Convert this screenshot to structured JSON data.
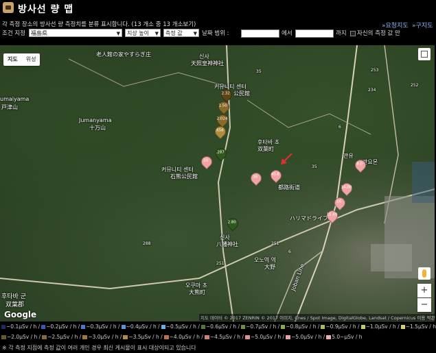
{
  "header": {
    "title": "방사선 량 맵",
    "description": "각 측정 장소의 방사선 량 측정치를 분류 표시합니다. (13 개소 중 13 개소보기)",
    "link_prefecture": "»요청지도",
    "link_city": "»구지도"
  },
  "filters": {
    "condition_label": "조건 지정",
    "prefecture_value": "福島県",
    "height_value": "지상 높이",
    "value_type": "측정 값",
    "date_range_label": "날짜 범위 :",
    "from_label": "에서",
    "to_label": "까지",
    "own_only_label": "자신의 측정 값 만"
  },
  "map": {
    "type_map": "지도",
    "type_satellite": "위성",
    "labels": {
      "top_shrine": "老人館の家やすらぎ庄",
      "shinsai": "신사",
      "tenjin": "天照皇神神社",
      "community_top": "커뮤니티 센터",
      "kominkan_top": "公民館",
      "jumanyama_left": "umaiyama",
      "jumanyama_left_jp": "戸津山",
      "jumanyama": "Jumanyama",
      "jumanyama_jp": "十万山",
      "futaba_town": "후타바 초",
      "futaba_town_jp": "双葉町",
      "community_mid": "커뮤니티 센터",
      "community_mid_jp": "石熊公民館",
      "road_jp": "都路街道",
      "harima": "ハリマドライブ",
      "shinsai_bottom": "신사",
      "hachiman": "八幡神社",
      "okuma": "오쿠마 초",
      "okuma_jp": "大熊町",
      "futaba_gun": "후타바 군",
      "futaba_gun_jp": "双葉郡",
      "oono": "오노역 역",
      "oono_jp": "大野",
      "joban": "Joban Line",
      "kanyu": "관유",
      "kanyu_jp": "관요몬",
      "route_288": "288",
      "route_6": "6",
      "route_35": "35",
      "route_251": "251",
      "route_253": "253",
      "route_252": "252",
      "route_234": "234",
      "route_251b": "251",
      "route_6b": "6",
      "route_35b": "35"
    },
    "pins": [
      {
        "value": "2.32",
        "tone": "dark"
      },
      {
        "value": "1.50",
        "tone": "mid"
      },
      {
        "value": "2.024",
        "tone": "mid"
      },
      {
        "value": ".656",
        "tone": "light"
      },
      {
        "value": ".287",
        "tone": "green"
      },
      {
        "value": "2.80",
        "tone": "green"
      },
      {
        "value": "30",
        "tone": "pink"
      },
      {
        "value": "38",
        "tone": "pink"
      },
      {
        "value": "40.8",
        "tone": "pink"
      },
      {
        "value": "8.0",
        "tone": "pink"
      },
      {
        "value": "14.00",
        "tone": "pink"
      },
      {
        "value": "16",
        "tone": "pink"
      },
      {
        "value": "15.40",
        "tone": "pink"
      }
    ],
    "google": "Google",
    "attribution": "지도 데이터 © 2017 ZENRIN © 2017 이미지, Cnes / Spot Image, DigitalGlobe, Landsat / Copernicus 이용 약관"
  },
  "legend": {
    "row1": [
      {
        "label": "~0.1μSv / h",
        "color": "#1f2a6b"
      },
      {
        "label": "~0.2μSv / h",
        "color": "#3a58b0"
      },
      {
        "label": "~0.3μSv / h",
        "color": "#4a78d0"
      },
      {
        "label": "~0.4μSv / h",
        "color": "#5a92e0"
      },
      {
        "label": "~0.5μSv / h",
        "color": "#6ab0e8"
      },
      {
        "label": "~0.6μSv / h",
        "color": "#4e7a3a"
      },
      {
        "label": "~0.7μSv / h",
        "color": "#6a9040"
      },
      {
        "label": "~0.8μSv / h",
        "color": "#8aaa4a"
      },
      {
        "label": "~0.9μSv / h",
        "color": "#a4c058"
      },
      {
        "label": "~1.0μSv / h",
        "color": "#c0d068"
      },
      {
        "label": "~1.5μSv / h",
        "color": "#d8d070"
      }
    ],
    "row2": [
      {
        "label": "~2.0μSv / h",
        "color": "#6a5a2a"
      },
      {
        "label": "~2.5μSv / h",
        "color": "#8a6a30"
      },
      {
        "label": "~3.0μSv / h",
        "color": "#a07838"
      },
      {
        "label": "~3.5μSv / h",
        "color": "#b08a48"
      },
      {
        "label": "~4.0μSv / h",
        "color": "#c07050"
      },
      {
        "label": "~4.5μSv / h",
        "color": "#d08070"
      },
      {
        "label": "~5.0μSv / h",
        "color": "#e09090"
      },
      {
        "label": "~5.0μSv / h",
        "color": "#e8a0a0"
      },
      {
        "label": "5.0~μSv / h",
        "color": "#f0b0b0"
      }
    ],
    "note": "※ 각 측정 지점에 측정 값이 여러 개인 경우 최신 게시물이 표시 대상이되고 있습니다"
  }
}
